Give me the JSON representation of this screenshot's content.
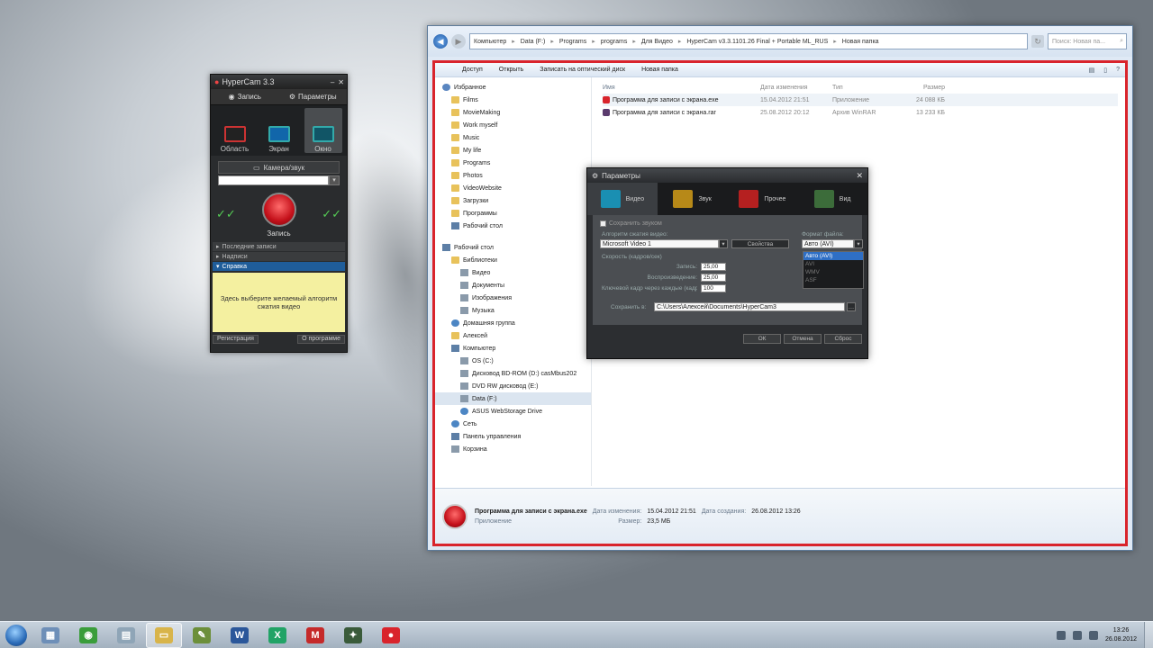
{
  "hypercam": {
    "title": "HyperCam 3.3",
    "tabs": [
      "Запись",
      "Параметры"
    ],
    "modes": [
      "Область",
      "Экран",
      "Окно"
    ],
    "camera_button": "Камера/звук",
    "record_label": "Запись",
    "sections": [
      "Последние записи",
      "Надписи",
      "Справка"
    ],
    "help_text": "Здесь выберите желаемый алгоритм сжатия видео",
    "bottom_left": "Регистрация",
    "bottom_right": "О программе"
  },
  "explorer": {
    "breadcrumbs": [
      "Компьютер",
      "Data (F:)",
      "Programs",
      "programs",
      "Для Видео",
      "HyperCam v3.3.1101.26 Final + Portable ML_RUS",
      "Новая папка"
    ],
    "search_placeholder": "Поиск: Новая па...",
    "toolbar": [
      "Доступ",
      "Открыть",
      "Записать на оптический диск",
      "Новая папка"
    ],
    "nav": [
      {
        "label": "Избранное",
        "kind": "star",
        "indent": 0
      },
      {
        "label": "Films",
        "kind": "fold",
        "indent": 1
      },
      {
        "label": "MovieMaking",
        "kind": "fold",
        "indent": 1
      },
      {
        "label": "Work myself",
        "kind": "fold",
        "indent": 1
      },
      {
        "label": "Music",
        "kind": "fold",
        "indent": 1
      },
      {
        "label": "My life",
        "kind": "fold",
        "indent": 1
      },
      {
        "label": "Programs",
        "kind": "fold",
        "indent": 1
      },
      {
        "label": "Photos",
        "kind": "fold",
        "indent": 1
      },
      {
        "label": "VideoWebsite",
        "kind": "fold",
        "indent": 1
      },
      {
        "label": "Загрузки",
        "kind": "fold",
        "indent": 1
      },
      {
        "label": "Программы",
        "kind": "fold",
        "indent": 1
      },
      {
        "label": "Рабочий стол",
        "kind": "pc",
        "indent": 1
      },
      {
        "label": "",
        "kind": "gap",
        "indent": 0
      },
      {
        "label": "Рабочий стол",
        "kind": "pc",
        "indent": 0
      },
      {
        "label": "Библиотеки",
        "kind": "fold",
        "indent": 1
      },
      {
        "label": "Видео",
        "kind": "drv",
        "indent": 2
      },
      {
        "label": "Документы",
        "kind": "drv",
        "indent": 2
      },
      {
        "label": "Изображения",
        "kind": "drv",
        "indent": 2
      },
      {
        "label": "Музыка",
        "kind": "drv",
        "indent": 2
      },
      {
        "label": "Домашняя группа",
        "kind": "net",
        "indent": 1
      },
      {
        "label": "Алексей",
        "kind": "fold",
        "indent": 1
      },
      {
        "label": "Компьютер",
        "kind": "pc",
        "indent": 1
      },
      {
        "label": "OS (C:)",
        "kind": "drv",
        "indent": 2
      },
      {
        "label": "Дисковод BD-ROM (D:) cаsMbus202",
        "kind": "drv",
        "indent": 2
      },
      {
        "label": "DVD RW дисковод (E:)",
        "kind": "drv",
        "indent": 2
      },
      {
        "label": "Data (F:)",
        "kind": "drv",
        "indent": 2,
        "selected": true
      },
      {
        "label": "ASUS WebStorage Drive",
        "kind": "net",
        "indent": 2
      },
      {
        "label": "Сеть",
        "kind": "net",
        "indent": 1
      },
      {
        "label": "Панель управления",
        "kind": "pc",
        "indent": 1
      },
      {
        "label": "Корзина",
        "kind": "drv",
        "indent": 1
      }
    ],
    "columns": [
      "Имя",
      "Дата изменения",
      "Тип",
      "Размер"
    ],
    "files": [
      {
        "name": "Программа для записи с экрана.exe",
        "date": "15.04.2012 21:51",
        "type": "Приложение",
        "size": "24 088 КБ",
        "color": "#d9242c"
      },
      {
        "name": "Программа для записи с экрана.rar",
        "date": "25.08.2012 20:12",
        "type": "Архив WinRAR",
        "size": "13 233 КБ",
        "color": "#5a3b6d"
      }
    ],
    "status": {
      "name": "Программа для записи с экрана.exe",
      "modified_label": "Дата изменения:",
      "modified": "15.04.2012 21:51",
      "created_label": "Дата создания:",
      "created": "26.08.2012 13:26",
      "type": "Приложение",
      "size_label": "Размер:",
      "size": "23,5 МБ"
    }
  },
  "dialog": {
    "title": "Параметры",
    "tabs": [
      {
        "label": "Видео",
        "color": "#1a8fb2"
      },
      {
        "label": "Звук",
        "color": "#b78918"
      },
      {
        "label": "Прочее",
        "color": "#b52020"
      },
      {
        "label": "Вид",
        "color": "#3c6c3a"
      }
    ],
    "checkbox": "Сохранить звуком",
    "codec_label": "Алгоритм сжатия видео:",
    "codec_value": "Microsoft Video 1",
    "properties_button": "Свойства",
    "format_label": "Формат файла:",
    "format_value": "Авто (AVI)",
    "format_options": [
      "Авто (AVI)",
      "AVI",
      "WMV",
      "ASF"
    ],
    "quality_label": "Скорость (кадров/сек)",
    "fields": [
      {
        "label": "Запись:",
        "value": "25,00"
      },
      {
        "label": "Воспроизведение:",
        "value": "25,00"
      },
      {
        "label": "Ключевой кадр через каждые (кадров):",
        "value": "100"
      }
    ],
    "save_label": "Сохранить в:",
    "save_path": "C:\\Users\\Алексей\\Documents\\HyperCam3",
    "buttons": [
      "ОК",
      "Отмена",
      "Сброс"
    ]
  },
  "taskbar": {
    "items": [
      {
        "name": "explorer",
        "glyph": "▦",
        "color": "#6e8fb8"
      },
      {
        "name": "chrome",
        "glyph": "◉",
        "color": "#3a9d3a"
      },
      {
        "name": "notepad",
        "glyph": "▤",
        "color": "#8fa5b7"
      },
      {
        "name": "folder",
        "glyph": "▭",
        "color": "#d8b44a",
        "active": true
      },
      {
        "name": "tool",
        "glyph": "✎",
        "color": "#6c8f3a"
      },
      {
        "name": "word",
        "glyph": "W",
        "color": "#2b579a"
      },
      {
        "name": "excel",
        "glyph": "X",
        "color": "#21a366"
      },
      {
        "name": "media",
        "glyph": "M",
        "color": "#c52a2a"
      },
      {
        "name": "app",
        "glyph": "✦",
        "color": "#3a5b3a"
      },
      {
        "name": "hypercam",
        "glyph": "●",
        "color": "#d9242c"
      }
    ],
    "time": "13:26",
    "date": "26.08.2012"
  }
}
